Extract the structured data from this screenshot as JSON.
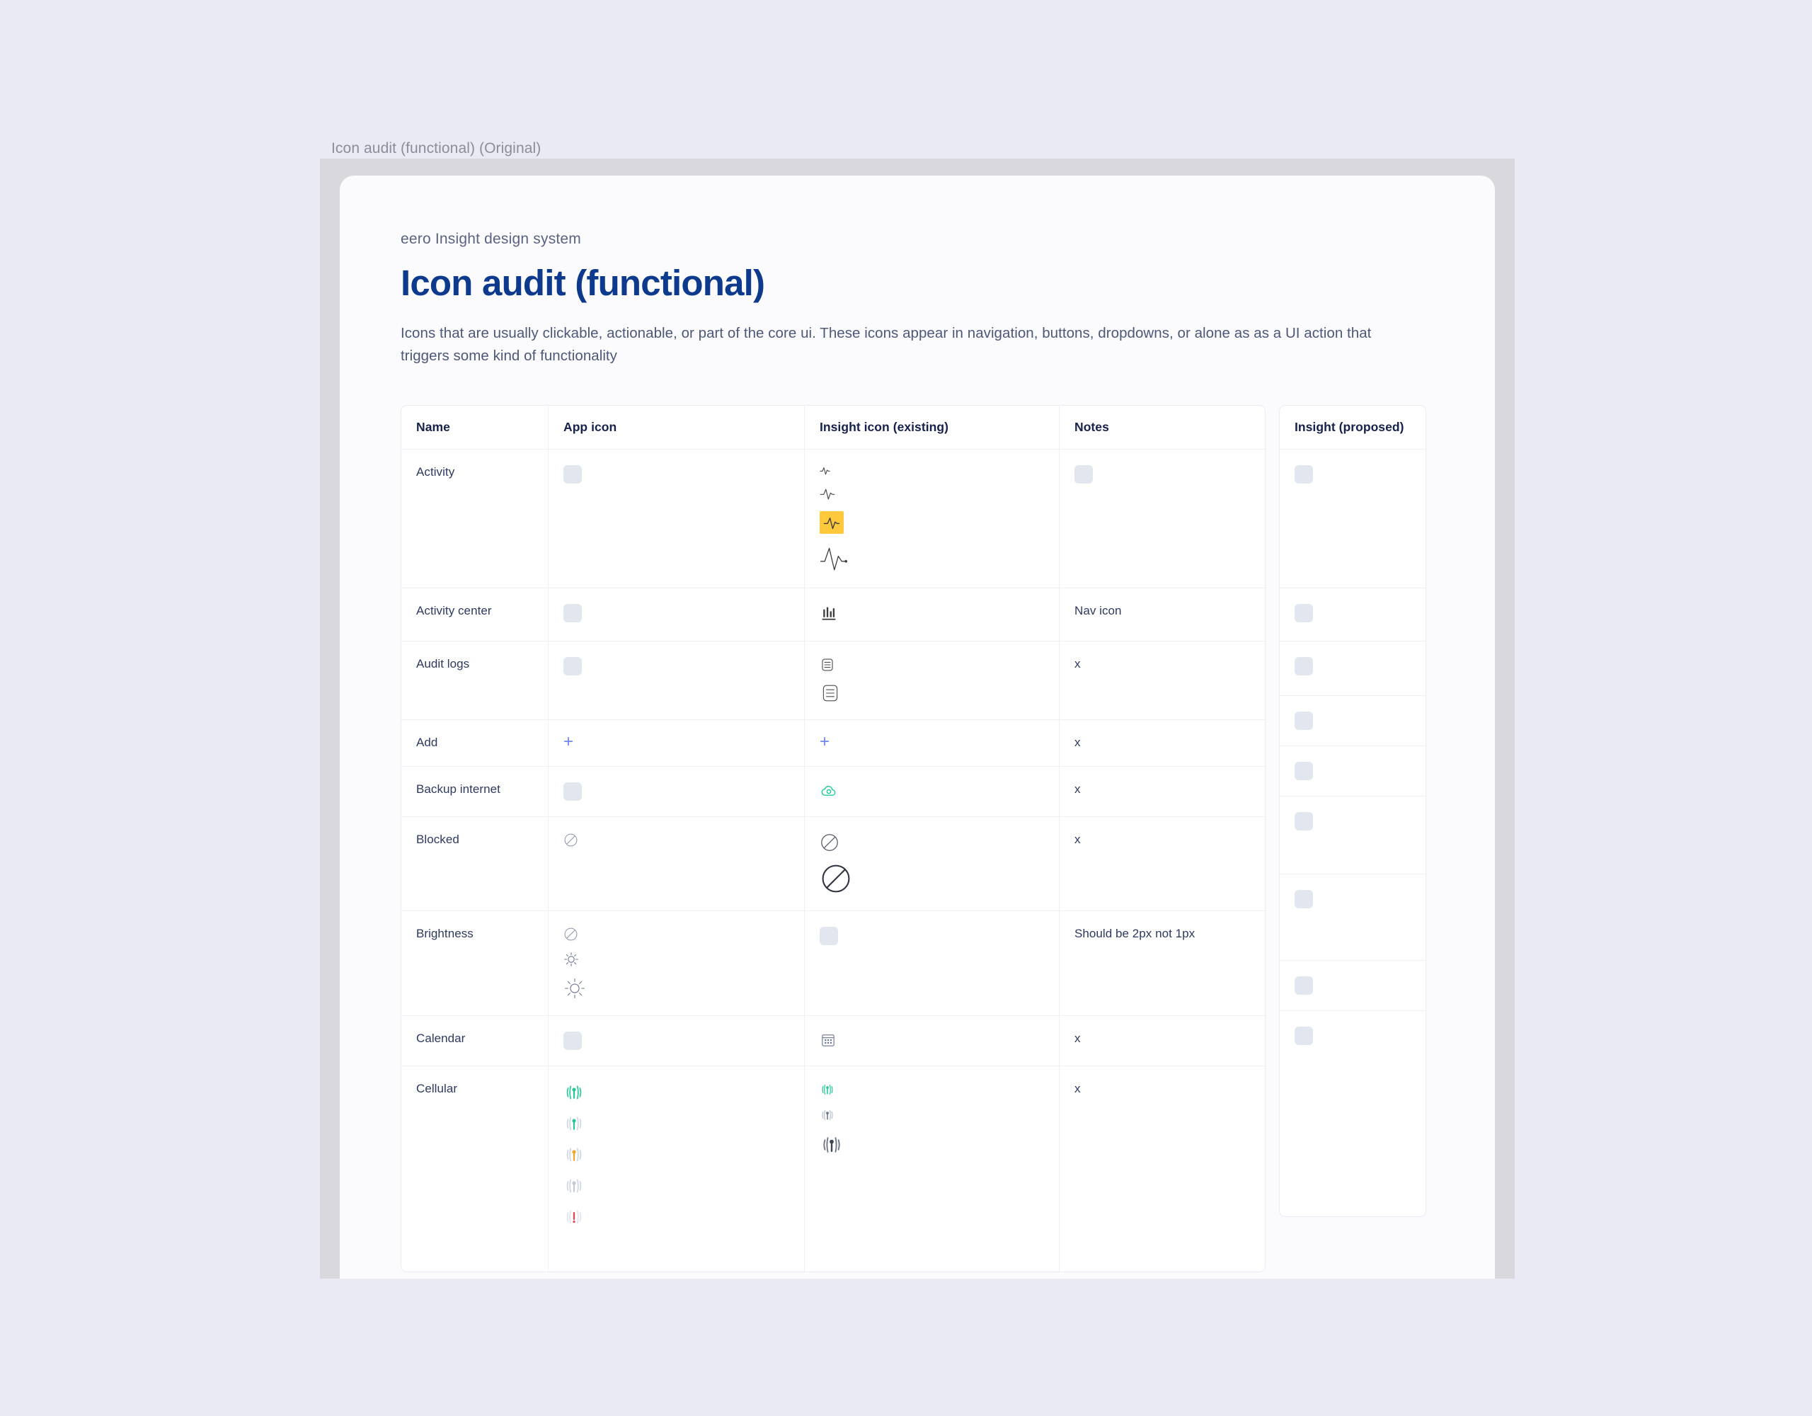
{
  "frame": {
    "label": "Icon audit (functional) (Original)"
  },
  "header": {
    "eyebrow": "eero Insight design system",
    "title": "Icon audit (functional)",
    "description": "Icons that are usually clickable, actionable, or part of the core ui. These icons appear in navigation, buttons, dropdowns, or alone as as a UI action that triggers some kind of functionality"
  },
  "table": {
    "columns": [
      {
        "key": "name",
        "label": "Name"
      },
      {
        "key": "app",
        "label": "App icon"
      },
      {
        "key": "insight",
        "label": "Insight icon (existing)"
      },
      {
        "key": "notes",
        "label": "Notes"
      }
    ],
    "proposed_column": {
      "key": "proposed",
      "label": "Insight (proposed)"
    },
    "rows": [
      {
        "name": "Activity",
        "notes": "",
        "app_icons": [
          "placeholder"
        ],
        "insight_icons": [
          "activity-wave-xs",
          "activity-wave-sm",
          "activity-wave-md-highlighted",
          "activity-wave-lg"
        ],
        "notes_icons": [
          "placeholder"
        ],
        "proposed_icons": [
          "placeholder"
        ]
      },
      {
        "name": "Activity center",
        "notes": "Nav icon",
        "app_icons": [
          "placeholder"
        ],
        "insight_icons": [
          "bar-chart-icon"
        ],
        "notes_icons": [],
        "proposed_icons": [
          "placeholder"
        ]
      },
      {
        "name": "Audit logs",
        "notes": "x",
        "app_icons": [
          "placeholder"
        ],
        "insight_icons": [
          "document-list-sm",
          "document-list-lg"
        ],
        "notes_icons": [],
        "proposed_icons": [
          "placeholder"
        ]
      },
      {
        "name": "Add",
        "notes": "x",
        "app_icons": [
          "plus-icon"
        ],
        "insight_icons": [
          "plus-icon"
        ],
        "notes_icons": [],
        "proposed_icons": [
          "placeholder"
        ]
      },
      {
        "name": "Backup internet",
        "notes": "x",
        "app_icons": [
          "placeholder"
        ],
        "insight_icons": [
          "cloud-backup-icon"
        ],
        "notes_icons": [],
        "proposed_icons": [
          "placeholder"
        ]
      },
      {
        "name": "Blocked",
        "notes": "x",
        "app_icons": [
          "blocked-circle-sm"
        ],
        "insight_icons": [
          "blocked-circle-md",
          "blocked-circle-lg"
        ],
        "notes_icons": [],
        "proposed_icons": [
          "placeholder"
        ]
      },
      {
        "name": "Brightness",
        "notes": "Should be 2px not 1px",
        "app_icons": [
          "blocked-circle-sm",
          "brightness-sun-sm",
          "brightness-sun-lg"
        ],
        "insight_icons": [
          "placeholder"
        ],
        "notes_icons": [],
        "proposed_icons": [
          "placeholder"
        ]
      },
      {
        "name": "Calendar",
        "notes": "x",
        "app_icons": [
          "placeholder"
        ],
        "insight_icons": [
          "calendar-icon"
        ],
        "notes_icons": [],
        "proposed_icons": [
          "placeholder"
        ]
      },
      {
        "name": "Cellular",
        "notes": "x",
        "app_icons": [
          "cellular-green-full",
          "cellular-green-mid",
          "cellular-orange-low",
          "cellular-gray-none",
          "cellular-red-alert"
        ],
        "insight_icons": [
          "cellular-teal-sm",
          "cellular-gray-sm",
          "cellular-gray-lg"
        ],
        "notes_icons": [],
        "proposed_icons": [
          "placeholder"
        ]
      }
    ]
  },
  "colors": {
    "page_background": "#eaeaf5",
    "frame_background": "#d8d8dd",
    "card_background": "#fbfbfd",
    "title": "#0d3a8c",
    "body_text": "#4d5878",
    "header_text": "#16224a",
    "placeholder": "#e1e6ef",
    "highlight_yellow": "#ffc83d",
    "accent_blue": "#6f86f0",
    "accent_green": "#20c997",
    "accent_orange": "#f5a524",
    "accent_red": "#e5484d",
    "grid_line": "#edf0f7"
  }
}
